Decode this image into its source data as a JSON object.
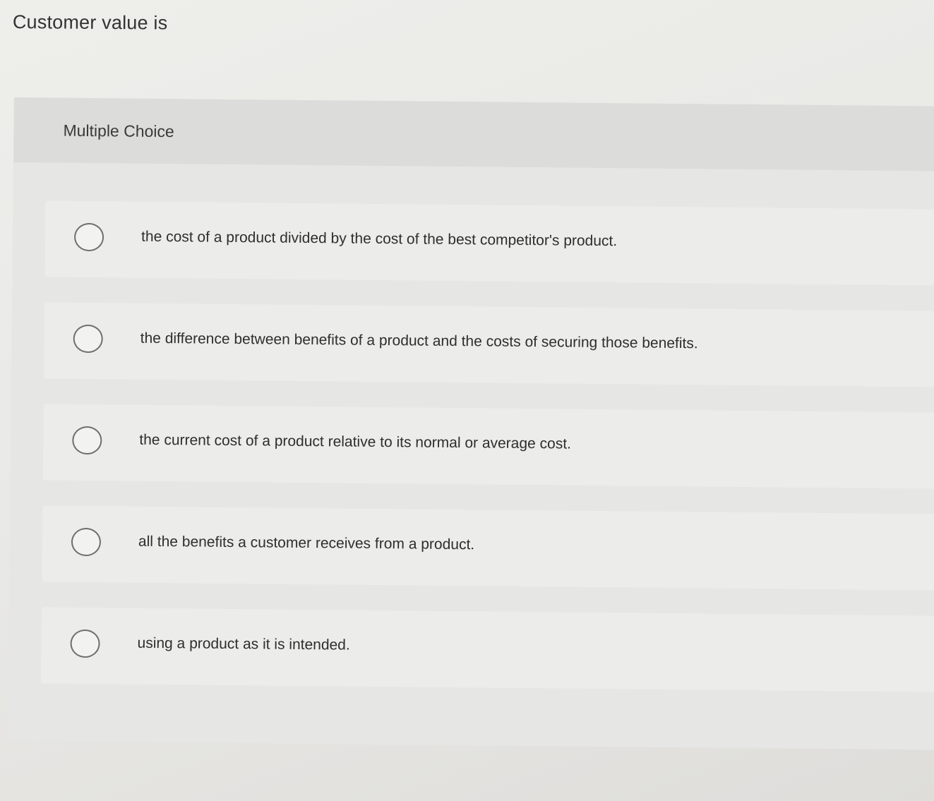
{
  "question": {
    "prompt": "Customer value is"
  },
  "multiple_choice": {
    "label": "Multiple Choice",
    "choices": [
      {
        "text": "the cost of a product divided by the cost of the best competitor's product."
      },
      {
        "text": "the difference between benefits of a product and the costs of securing those benefits."
      },
      {
        "text": "the current cost of a product relative to its normal or average cost."
      },
      {
        "text": "all the benefits a customer receives from a product."
      },
      {
        "text": "using a product as it is intended."
      }
    ]
  },
  "colors": {
    "page_background": "#eae9e6",
    "panel_background": "#e0e0de",
    "choice_background": "#ececea",
    "radio_border": "#6e6e6e",
    "text": "#2e2e2e"
  }
}
